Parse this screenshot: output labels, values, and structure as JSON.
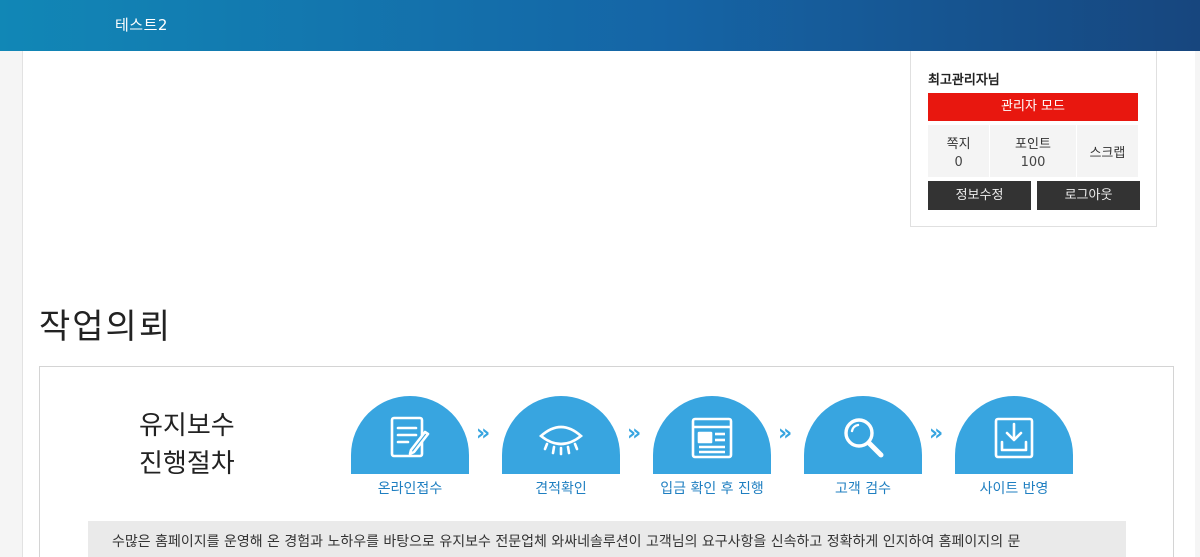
{
  "header": {
    "site_title": "테스트2"
  },
  "user_box": {
    "user_name": "최고관리자님",
    "admin_mode_label": "관리자 모드",
    "stats": [
      {
        "label": "쪽지",
        "value": "0"
      },
      {
        "label": "포인트",
        "value": "100"
      },
      {
        "label": "스크랩"
      }
    ],
    "edit_profile_label": "정보수정",
    "logout_label": "로그아웃"
  },
  "main": {
    "section_title": "작업의뢰",
    "process": {
      "title_line1": "유지보수",
      "title_line2": "진행절차",
      "steps": [
        {
          "label": "온라인접수",
          "icon": "form-pencil-icon"
        },
        {
          "label": "견적확인",
          "icon": "eye-icon"
        },
        {
          "label": "입금 확인 후 진행",
          "icon": "document-window-icon"
        },
        {
          "label": "고객 검수",
          "icon": "magnifier-icon"
        },
        {
          "label": "사이트 반영",
          "icon": "download-tray-icon"
        }
      ],
      "arrow_glyph": "»",
      "description": "수많은 홈페이지를 운영해 온 경험과 노하우를 바탕으로 유지보수 전문업체 와싸네솔루션이 고객님의 요구사항을 신속하고 정확하게 인지하여 홈페이지의 문"
    }
  },
  "colors": {
    "accent_blue": "#38a5e0",
    "admin_red": "#e8170f",
    "dark_button": "#333333"
  }
}
